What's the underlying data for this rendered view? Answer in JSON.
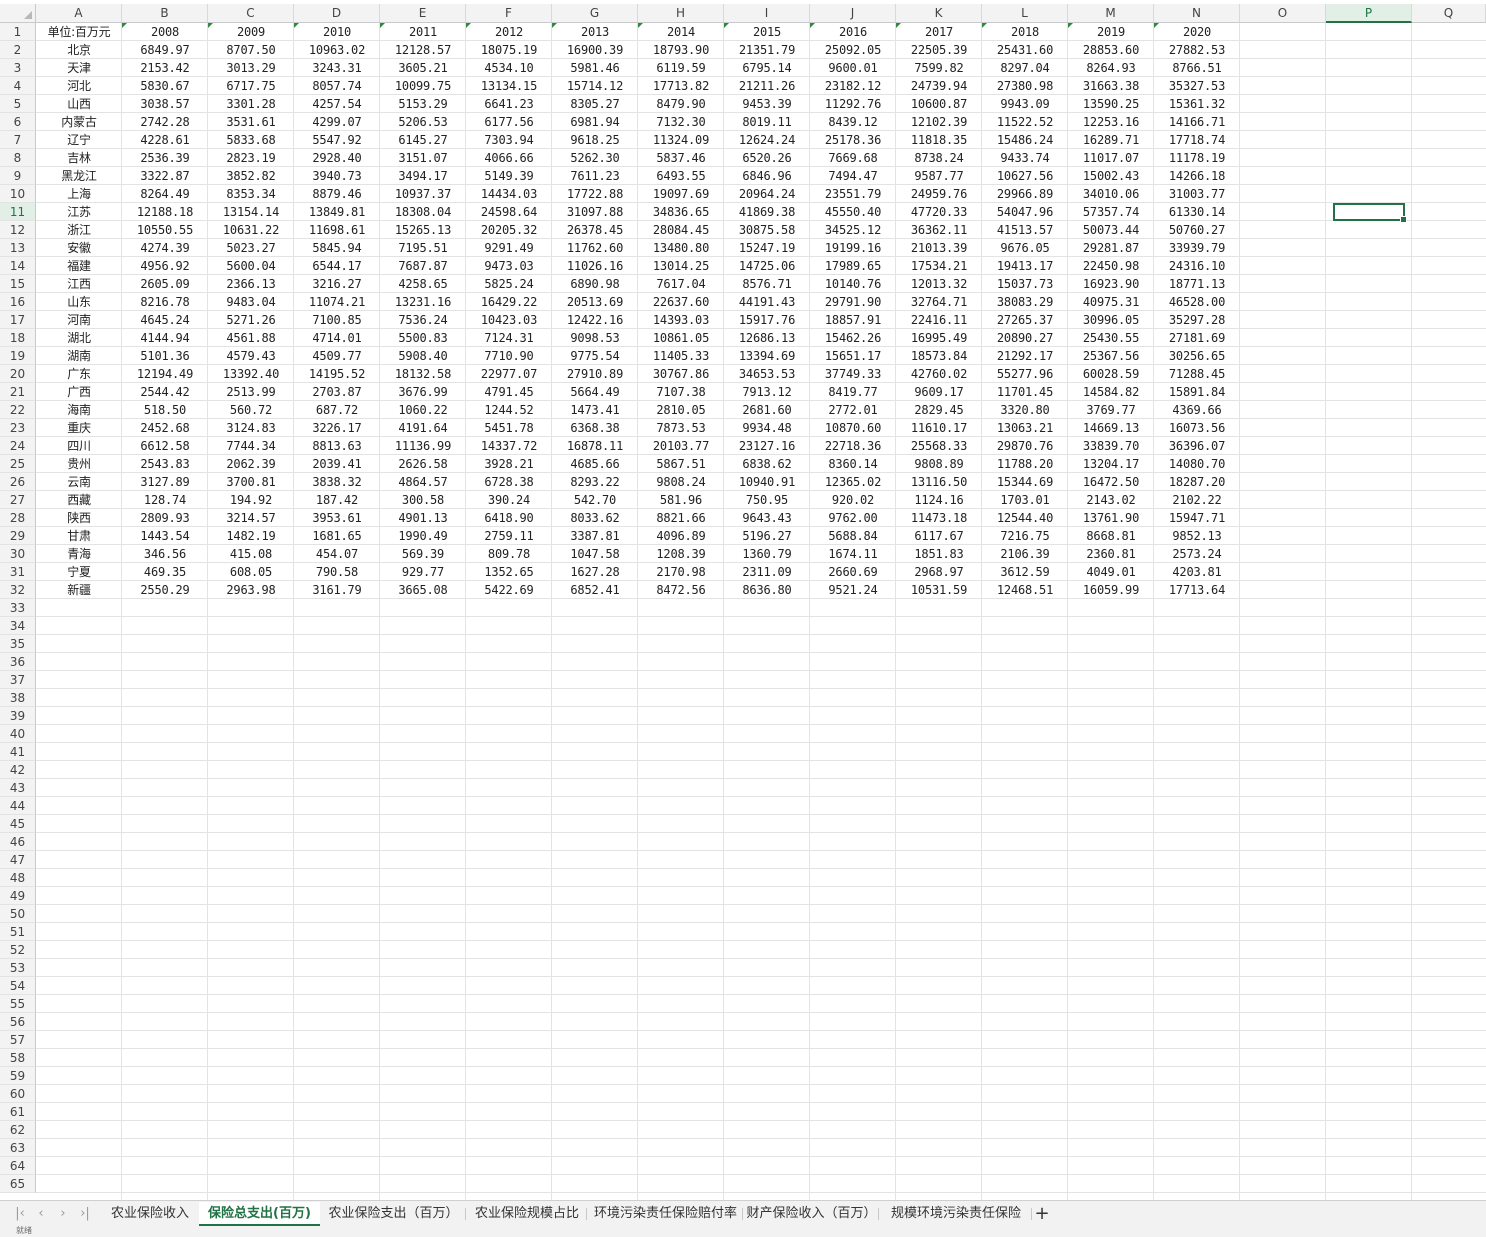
{
  "columns": [
    "A",
    "B",
    "C",
    "D",
    "E",
    "F",
    "G",
    "H",
    "I",
    "J",
    "K",
    "L",
    "M",
    "N",
    "O",
    "P",
    "Q"
  ],
  "active_column": "P",
  "active_row": 11,
  "row_count": 65,
  "header_row": [
    "单位:百万元",
    "2008",
    "2009",
    "2010",
    "2011",
    "2012",
    "2013",
    "2014",
    "2015",
    "2016",
    "2017",
    "2018",
    "2019",
    "2020"
  ],
  "rows": [
    [
      "北京",
      "6849.97",
      "8707.50",
      "10963.02",
      "12128.57",
      "18075.19",
      "16900.39",
      "18793.90",
      "21351.79",
      "25092.05",
      "22505.39",
      "25431.60",
      "28853.60",
      "27882.53"
    ],
    [
      "天津",
      "2153.42",
      "3013.29",
      "3243.31",
      "3605.21",
      "4534.10",
      "5981.46",
      "6119.59",
      "6795.14",
      "9600.01",
      "7599.82",
      "8297.04",
      "8264.93",
      "8766.51"
    ],
    [
      "河北",
      "5830.67",
      "6717.75",
      "8057.74",
      "10099.75",
      "13134.15",
      "15714.12",
      "17713.82",
      "21211.26",
      "23182.12",
      "24739.94",
      "27380.98",
      "31663.38",
      "35327.53"
    ],
    [
      "山西",
      "3038.57",
      "3301.28",
      "4257.54",
      "5153.29",
      "6641.23",
      "8305.27",
      "8479.90",
      "9453.39",
      "11292.76",
      "10600.87",
      "9943.09",
      "13590.25",
      "15361.32"
    ],
    [
      "内蒙古",
      "2742.28",
      "3531.61",
      "4299.07",
      "5206.53",
      "6177.56",
      "6981.94",
      "7132.30",
      "8019.11",
      "8439.12",
      "12102.39",
      "11522.52",
      "12253.16",
      "14166.71"
    ],
    [
      "辽宁",
      "4228.61",
      "5833.68",
      "5547.92",
      "6145.27",
      "7303.94",
      "9618.25",
      "11324.09",
      "12624.24",
      "25178.36",
      "11818.35",
      "15486.24",
      "16289.71",
      "17718.74"
    ],
    [
      "吉林",
      "2536.39",
      "2823.19",
      "2928.40",
      "3151.07",
      "4066.66",
      "5262.30",
      "5837.46",
      "6520.26",
      "7669.68",
      "8738.24",
      "9433.74",
      "11017.07",
      "11178.19"
    ],
    [
      "黑龙江",
      "3322.87",
      "3852.82",
      "3940.73",
      "3494.17",
      "5149.39",
      "7611.23",
      "6493.55",
      "6846.96",
      "7494.47",
      "9587.77",
      "10627.56",
      "15002.43",
      "14266.18"
    ],
    [
      "上海",
      "8264.49",
      "8353.34",
      "8879.46",
      "10937.37",
      "14434.03",
      "17722.88",
      "19097.69",
      "20964.24",
      "23551.79",
      "24959.76",
      "29966.89",
      "34010.06",
      "31003.77"
    ],
    [
      "江苏",
      "12188.18",
      "13154.14",
      "13849.81",
      "18308.04",
      "24598.64",
      "31097.88",
      "34836.65",
      "41869.38",
      "45550.40",
      "47720.33",
      "54047.96",
      "57357.74",
      "61330.14"
    ],
    [
      "浙江",
      "10550.55",
      "10631.22",
      "11698.61",
      "15265.13",
      "20205.32",
      "26378.45",
      "28084.45",
      "30875.58",
      "34525.12",
      "36362.11",
      "41513.57",
      "50073.44",
      "50760.27"
    ],
    [
      "安徽",
      "4274.39",
      "5023.27",
      "5845.94",
      "7195.51",
      "9291.49",
      "11762.60",
      "13480.80",
      "15247.19",
      "19199.16",
      "21013.39",
      "9676.05",
      "29281.87",
      "33939.79"
    ],
    [
      "福建",
      "4956.92",
      "5600.04",
      "6544.17",
      "7687.87",
      "9473.03",
      "11026.16",
      "13014.25",
      "14725.06",
      "17989.65",
      "17534.21",
      "19413.17",
      "22450.98",
      "24316.10"
    ],
    [
      "江西",
      "2605.09",
      "2366.13",
      "3216.27",
      "4258.65",
      "5825.24",
      "6890.98",
      "7617.04",
      "8576.71",
      "10140.76",
      "12013.32",
      "15037.73",
      "16923.90",
      "18771.13"
    ],
    [
      "山东",
      "8216.78",
      "9483.04",
      "11074.21",
      "13231.16",
      "16429.22",
      "20513.69",
      "22637.60",
      "44191.43",
      "29791.90",
      "32764.71",
      "38083.29",
      "40975.31",
      "46528.00"
    ],
    [
      "河南",
      "4645.24",
      "5271.26",
      "7100.85",
      "7536.24",
      "10423.03",
      "12422.16",
      "14393.03",
      "15917.76",
      "18857.91",
      "22416.11",
      "27265.37",
      "30996.05",
      "35297.28"
    ],
    [
      "湖北",
      "4144.94",
      "4561.88",
      "4714.01",
      "5500.83",
      "7124.31",
      "9098.53",
      "10861.05",
      "12686.13",
      "15462.26",
      "16995.49",
      "20890.27",
      "25430.55",
      "27181.69"
    ],
    [
      "湖南",
      "5101.36",
      "4579.43",
      "4509.77",
      "5908.40",
      "7710.90",
      "9775.54",
      "11405.33",
      "13394.69",
      "15651.17",
      "18573.84",
      "21292.17",
      "25367.56",
      "30256.65"
    ],
    [
      "广东",
      "12194.49",
      "13392.40",
      "14195.52",
      "18132.58",
      "22977.07",
      "27910.89",
      "30767.86",
      "34653.53",
      "37749.33",
      "42760.02",
      "55277.96",
      "60028.59",
      "71288.45"
    ],
    [
      "广西",
      "2544.42",
      "2513.99",
      "2703.87",
      "3676.99",
      "4791.45",
      "5664.49",
      "7107.38",
      "7913.12",
      "8419.77",
      "9609.17",
      "11701.45",
      "14584.82",
      "15891.84"
    ],
    [
      "海南",
      "518.50",
      "560.72",
      "687.72",
      "1060.22",
      "1244.52",
      "1473.41",
      "2810.05",
      "2681.60",
      "2772.01",
      "2829.45",
      "3320.80",
      "3769.77",
      "4369.66"
    ],
    [
      "重庆",
      "2452.68",
      "3124.83",
      "3226.17",
      "4191.64",
      "5451.78",
      "6368.38",
      "7873.53",
      "9934.48",
      "10870.60",
      "11610.17",
      "13063.21",
      "14669.13",
      "16073.56"
    ],
    [
      "四川",
      "6612.58",
      "7744.34",
      "8813.63",
      "11136.99",
      "14337.72",
      "16878.11",
      "20103.77",
      "23127.16",
      "22718.36",
      "25568.33",
      "29870.76",
      "33839.70",
      "36396.07"
    ],
    [
      "贵州",
      "2543.83",
      "2062.39",
      "2039.41",
      "2626.58",
      "3928.21",
      "4685.66",
      "5867.51",
      "6838.62",
      "8360.14",
      "9808.89",
      "11788.20",
      "13204.17",
      "14080.70"
    ],
    [
      "云南",
      "3127.89",
      "3700.81",
      "3838.32",
      "4864.57",
      "6728.38",
      "8293.22",
      "9808.24",
      "10940.91",
      "12365.02",
      "13116.50",
      "15344.69",
      "16472.50",
      "18287.20"
    ],
    [
      "西藏",
      "128.74",
      "194.92",
      "187.42",
      "300.58",
      "390.24",
      "542.70",
      "581.96",
      "750.95",
      "920.02",
      "1124.16",
      "1703.01",
      "2143.02",
      "2102.22"
    ],
    [
      "陕西",
      "2809.93",
      "3214.57",
      "3953.61",
      "4901.13",
      "6418.90",
      "8033.62",
      "8821.66",
      "9643.43",
      "9762.00",
      "11473.18",
      "12544.40",
      "13761.90",
      "15947.71"
    ],
    [
      "甘肃",
      "1443.54",
      "1482.19",
      "1681.65",
      "1990.49",
      "2759.11",
      "3387.81",
      "4096.89",
      "5196.27",
      "5688.84",
      "6117.67",
      "7216.75",
      "8668.81",
      "9852.13"
    ],
    [
      "青海",
      "346.56",
      "415.08",
      "454.07",
      "569.39",
      "809.78",
      "1047.58",
      "1208.39",
      "1360.79",
      "1674.11",
      "1851.83",
      "2106.39",
      "2360.81",
      "2573.24"
    ],
    [
      "宁夏",
      "469.35",
      "608.05",
      "790.58",
      "929.77",
      "1352.65",
      "1627.28",
      "2170.98",
      "2311.09",
      "2660.69",
      "2968.97",
      "3612.59",
      "4049.01",
      "4203.81"
    ],
    [
      "新疆",
      "2550.29",
      "2963.98",
      "3161.79",
      "3665.08",
      "5422.69",
      "6852.41",
      "8472.56",
      "8636.80",
      "9521.24",
      "10531.59",
      "12468.51",
      "16059.99",
      "17713.64"
    ]
  ],
  "tabs": [
    {
      "label": "农业保险收入",
      "active": false
    },
    {
      "label": "保险总支出(百万)",
      "active": true
    },
    {
      "label": "农业保险支出（百万）",
      "active": false
    },
    {
      "label": "农业保险规模占比",
      "active": false
    },
    {
      "label": "环境污染责任保险赔付率",
      "active": false
    },
    {
      "label": "财产保险收入（百万）",
      "active": false
    },
    {
      "label": "规模环境污染责任保险",
      "active": false
    }
  ],
  "nav_icons": [
    "first-sheet-icon",
    "prev-sheet-icon",
    "next-sheet-icon",
    "last-sheet-icon"
  ],
  "nav_glyphs": [
    "|‹",
    "‹",
    "›",
    "›|"
  ],
  "add_tab_glyph": "+",
  "status_text": "就绪",
  "colors": {
    "accent": "#217346",
    "grid": "#e3e3e3",
    "header_bg": "#f3f3f3",
    "tab_bar": "#f2f2f2"
  }
}
